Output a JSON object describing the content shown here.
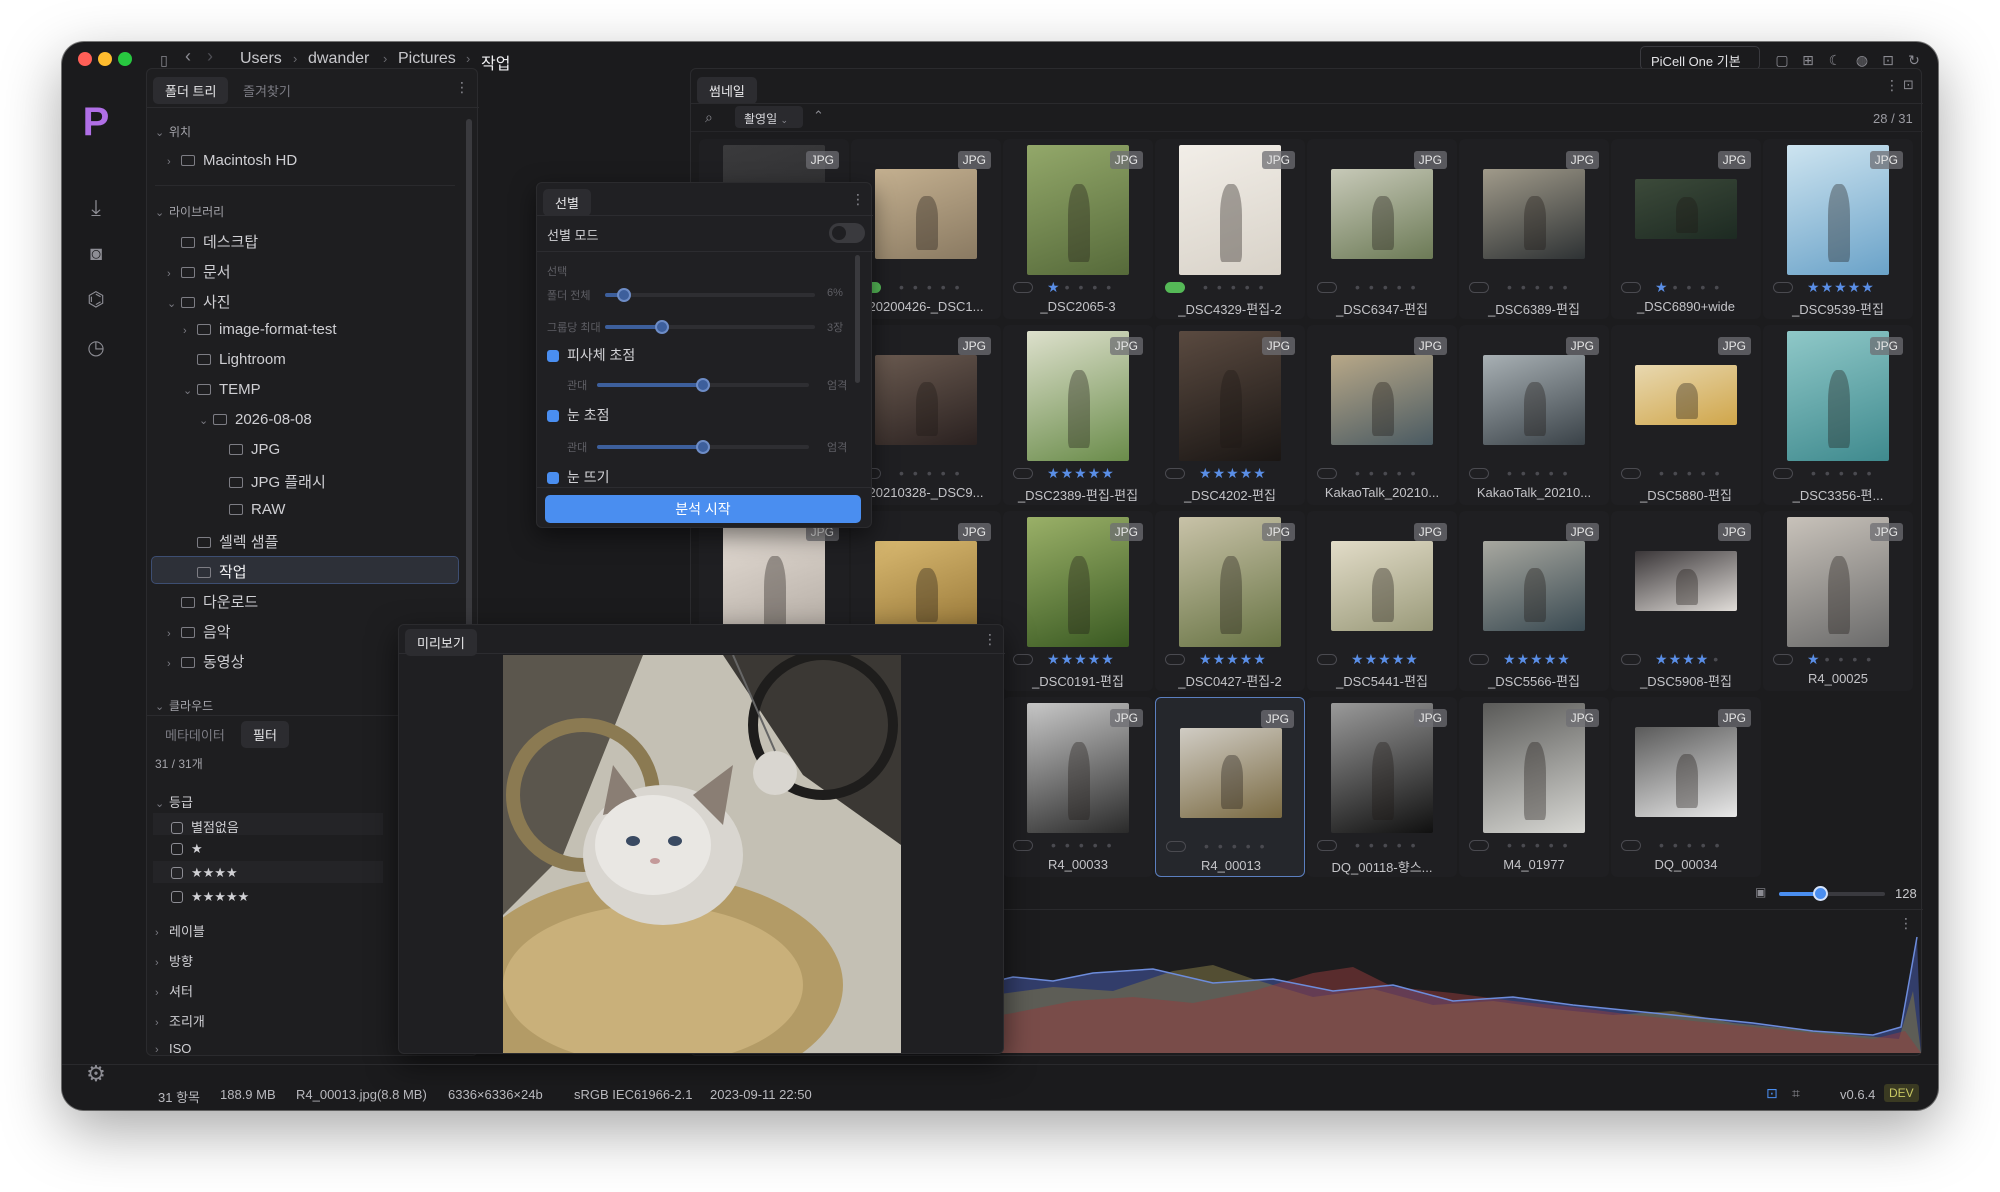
{
  "titlebar": {
    "breadcrumb": [
      "Users",
      "dwander",
      "Pictures",
      "작업"
    ],
    "preset": "PiCell One 기본"
  },
  "folder_panel": {
    "tabs": [
      "폴더 트리",
      "즐겨찾기"
    ],
    "sections": {
      "location": "위치",
      "library": "라이브러리",
      "cloud": "클라우드"
    },
    "tree": {
      "macintosh": "Macintosh HD",
      "desktop": "데스크탑",
      "documents": "문서",
      "photos": "사진",
      "image_format_test": "image-format-test",
      "lightroom": "Lightroom",
      "temp": "TEMP",
      "date_folder": "2026-08-08",
      "jpg": "JPG",
      "jpg_flash": "JPG 플래시",
      "raw": "RAW",
      "select_sample": "셀렉 샘플",
      "work": "작업",
      "downloads": "다운로드",
      "music": "음악",
      "videos": "동영상"
    }
  },
  "filter_panel": {
    "tabs": [
      "메타데이터",
      "필터"
    ],
    "count": "31 / 31개",
    "rating_header": "등급",
    "ratings": [
      "별점없음",
      "★",
      "★★★★",
      "★★★★★"
    ],
    "groups": [
      "레이블",
      "방향",
      "셔터",
      "조리개",
      "ISO"
    ]
  },
  "selection_panel": {
    "title": "선별",
    "mode_label": "선별 모드",
    "section": "선택",
    "folder_all_label": "폴더 전체",
    "folder_all_value": "6%",
    "group_max_label": "그룹당 최대",
    "group_max_value": "3장",
    "subject_focus": "피사체 초점",
    "eye_focus": "눈 초점",
    "eye_open": "눈 뜨기",
    "loose": "관대",
    "strict": "엄격",
    "start_button": "분석 시작",
    "folder_all_level": 0.09,
    "group_max_level": 0.27,
    "subject_level": 0.5,
    "eye_level": 0.5
  },
  "preview_panel": {
    "title": "미리보기"
  },
  "thumbnail_panel": {
    "title": "썸네일",
    "sort": "촬영일",
    "count": "28 / 31",
    "zoom_value": "128",
    "zoom_level": 0.4,
    "items": [
      {
        "name": "",
        "badge": "JPG",
        "rating": 0
      },
      {
        "name": "20200426-_DSC1...",
        "badge": "JPG",
        "rating": 0
      },
      {
        "name": "_DSC2065-3",
        "badge": "JPG",
        "rating": 1
      },
      {
        "name": "_DSC4329-편집-2",
        "badge": "JPG",
        "rating": 0
      },
      {
        "name": "_DSC6347-편집",
        "badge": "JPG",
        "rating": 0
      },
      {
        "name": "_DSC6389-편집",
        "badge": "JPG",
        "rating": 0
      },
      {
        "name": "_DSC6890+wide",
        "badge": "JPG",
        "rating": 1
      },
      {
        "name": "_DSC9539-편집",
        "badge": "JPG",
        "rating": 5
      },
      {
        "name": "",
        "badge": "JPG",
        "rating": 0
      },
      {
        "name": "20210328-_DSC9...",
        "badge": "JPG",
        "rating": 0
      },
      {
        "name": "_DSC2389-편집-편집",
        "badge": "JPG",
        "rating": 5
      },
      {
        "name": "_DSC4202-편집",
        "badge": "JPG",
        "rating": 5
      },
      {
        "name": "KakaoTalk_20210...",
        "badge": "JPG",
        "rating": 0
      },
      {
        "name": "KakaoTalk_20210...",
        "badge": "JPG",
        "rating": 0
      },
      {
        "name": "_DSC5880-편집",
        "badge": "JPG",
        "rating": 0
      },
      {
        "name": "_DSC3356-편...",
        "badge": "JPG",
        "rating": 0
      },
      {
        "name": "",
        "badge": "JPG",
        "rating": 0
      },
      {
        "name": "",
        "badge": "JPG",
        "rating": 0
      },
      {
        "name": "_DSC0191-편집",
        "badge": "JPG",
        "rating": 5
      },
      {
        "name": "_DSC0427-편집-2",
        "badge": "JPG",
        "rating": 5
      },
      {
        "name": "_DSC5441-편집",
        "badge": "JPG",
        "rating": 5
      },
      {
        "name": "_DSC5566-편집",
        "badge": "JPG",
        "rating": 5
      },
      {
        "name": "_DSC5908-편집",
        "badge": "JPG",
        "rating": 4
      },
      {
        "name": "R4_00025",
        "badge": "JPG",
        "rating": 1
      },
      {
        "name": "R4_00033",
        "badge": "JPG",
        "rating": 0
      },
      {
        "name": "R4_00013",
        "badge": "JPG",
        "rating": 0
      },
      {
        "name": "DQ_00118-향스...",
        "badge": "JPG",
        "rating": 0
      },
      {
        "name": "M4_01977",
        "badge": "JPG",
        "rating": 0
      },
      {
        "name": "DQ_00034",
        "badge": "JPG",
        "rating": 0
      }
    ]
  },
  "statusbar": {
    "items_count": "31 항목",
    "total_size": "188.9 MB",
    "file": "R4_00013.jpg(8.8 MB)",
    "dimensions": "6336×6336×24b",
    "colorspace": "sRGB IEC61966-2.1",
    "datetime": "2023-09-11 22:50",
    "version": "v0.6.4",
    "build": "DEV"
  },
  "colors": {
    "accent": "#4a8ef0",
    "star": "#5a8ee6",
    "label_green": "#55b957"
  }
}
